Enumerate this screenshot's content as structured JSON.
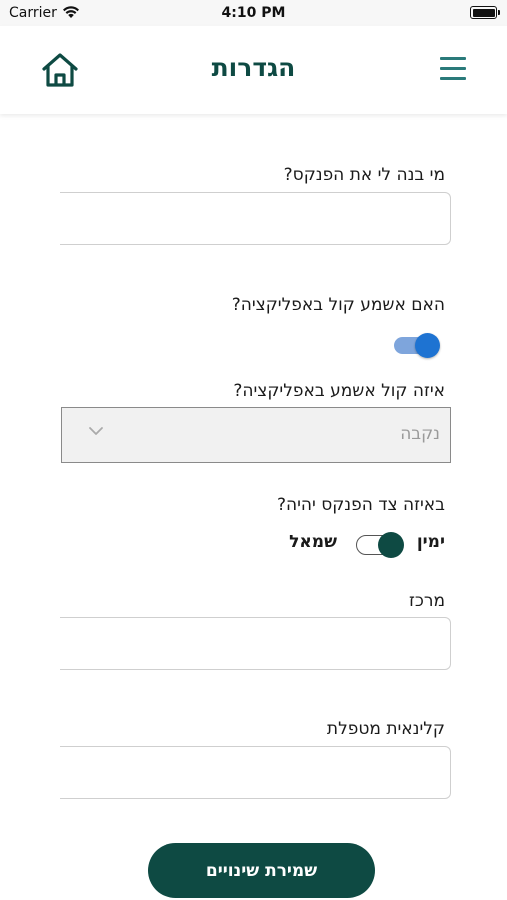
{
  "status_bar": {
    "carrier": "Carrier",
    "time": "4:10 PM",
    "icons": [
      "wifi-icon",
      "battery-icon"
    ]
  },
  "header": {
    "title": "הגדרות",
    "home_icon": "home-icon",
    "menu_icon": "hamburger-menu-icon",
    "accent_color": "#0e4a43"
  },
  "form": {
    "builder": {
      "label": "מי בנה לי את הפנקס?",
      "value": ""
    },
    "sound": {
      "label": "האם אשמע קול באפליקציה?",
      "enabled": true
    },
    "voice": {
      "label": "איזה קול אשמע באפליקציה?",
      "selected": "נקבה"
    },
    "side": {
      "label": "באיזה צד הפנקס יהיה?",
      "option_right": "ימין",
      "option_left": "שמאל",
      "selected": "ימין"
    },
    "center": {
      "label": "מרכז",
      "value": ""
    },
    "clinician": {
      "label": "קלינאית מטפלת",
      "value": ""
    }
  },
  "save_button": {
    "label": "שמירת שינויים"
  }
}
